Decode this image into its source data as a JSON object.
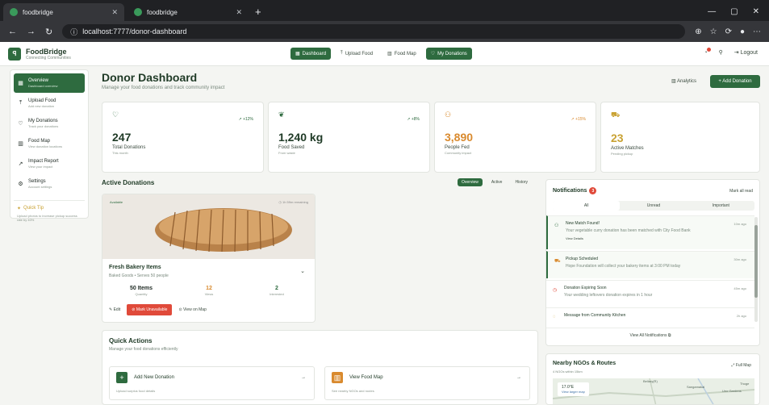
{
  "browser": {
    "tabs": [
      {
        "label": "foodbridge"
      },
      {
        "label": "foodbridge"
      }
    ],
    "url_prefix": "localhost:7777",
    "url_path": "/donor-dashboard"
  },
  "app": {
    "name": "FoodBridge",
    "tagline": "Connecting Communities",
    "nav": [
      {
        "label": "Dashboard"
      },
      {
        "label": "Upload Food"
      },
      {
        "label": "Food Map"
      },
      {
        "label": "My Donations"
      }
    ],
    "logout": "Logout"
  },
  "sidebar": {
    "items": [
      {
        "label": "Overview",
        "sub": "Dashboard overview"
      },
      {
        "label": "Upload Food",
        "sub": "Add new donation"
      },
      {
        "label": "My Donations",
        "sub": "Track your donations"
      },
      {
        "label": "Food Map",
        "sub": "View donation locations"
      },
      {
        "label": "Impact Report",
        "sub": "View your impact"
      },
      {
        "label": "Settings",
        "sub": "Account settings"
      }
    ],
    "tip_title": "Quick Tip",
    "tip_body": "Upload photos to increase pickup success rate by 40%"
  },
  "main": {
    "title": "Donor Dashboard",
    "subtitle": "Manage your food donations and track community impact",
    "analytics": "Analytics",
    "add_donation": "+ Add Donation"
  },
  "stats": [
    {
      "value": "247",
      "label": "Total Donations",
      "sub": "This month",
      "trend": "+12%"
    },
    {
      "value": "1,240 kg",
      "label": "Food Saved",
      "sub": "From waste",
      "trend": "+8%"
    },
    {
      "value": "3,890",
      "label": "People Fed",
      "sub": "Community impact",
      "trend": "+15%"
    },
    {
      "value": "23",
      "label": "Active Matches",
      "sub": "Pending pickup",
      "trend": ""
    }
  ],
  "active": {
    "title": "Active Donations",
    "tabs": [
      "Overview",
      "Active",
      "History"
    ],
    "donation": {
      "badge": "Available",
      "time": "1h 59m remaining",
      "name": "Fresh Bakery Items",
      "category": "Baked Goods • Serves 50 people",
      "quantity": "50 Items",
      "quantity_label": "Quantity",
      "views": "12",
      "views_label": "Views",
      "interested": "2",
      "interested_label": "Interested",
      "edit": "Edit",
      "unavailable": "Mark Unavailable",
      "view_map": "View on Map"
    }
  },
  "quick": {
    "title": "Quick Actions",
    "subtitle": "Manage your food donations efficiently",
    "items": [
      {
        "title": "Add New Donation",
        "sub": "Upload surplus food details"
      },
      {
        "title": "View Food Map",
        "sub": "See nearby NGOs and routes"
      }
    ]
  },
  "notifications": {
    "title": "Notifications",
    "count": "3",
    "mark_all": "Mark all read",
    "tabs": [
      "All",
      "Unread",
      "Important"
    ],
    "items": [
      {
        "title": "New Match Found!",
        "body": "Your vegetable curry donation has been matched with City Food Bank",
        "time": "10m ago",
        "link": "View Details"
      },
      {
        "title": "Pickup Scheduled",
        "body": "Hope Foundation will collect your bakery items at 3:00 PM today",
        "time": "30m ago"
      },
      {
        "title": "Donation Expiring Soon",
        "body": "Your wedding leftovers donation expires in 1 hour",
        "time": "45m ago"
      },
      {
        "title": "Message from Community Kitchen",
        "body": "",
        "time": "2h ago"
      }
    ],
    "view_all": "View All Notifications"
  },
  "ngos": {
    "title": "Nearby NGOs & Routes",
    "subtitle": "4 NGOs within 15km",
    "full_map": "Full Map",
    "map_labels": [
      "Bellary(R)",
      "Sangamakal",
      "Thoge",
      "Uno Gardens"
    ],
    "popup": "17.0°E",
    "popup_link": "View larger map"
  },
  "colors": {
    "brand": "#2e6b3f",
    "danger": "#e04a3a",
    "orange": "#d98a2e",
    "gold": "#c9a233"
  }
}
